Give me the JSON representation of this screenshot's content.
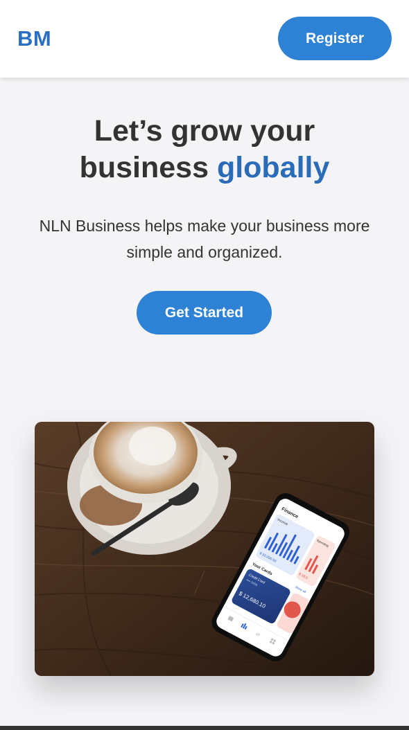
{
  "header": {
    "logo": "BM",
    "register_label": "Register"
  },
  "hero": {
    "title_line1": "Let’s grow your",
    "title_line2_plain": "business ",
    "title_line2_accent": "globally",
    "subtitle": "NLN Business helps make your business more simple and organized.",
    "cta_label": "Get Started"
  },
  "photo": {
    "phone_screen_title": "Finance",
    "income_label": "Income",
    "income_value": "$ 32,000.50",
    "spending_label": "Spending",
    "spending_value": "$ 18,0",
    "cards_label": "Your Cards",
    "show_all_label": "Show all",
    "card_name": "Credit Card",
    "card_number": "•••• 3456",
    "card_balance": "$ 12,680.10"
  },
  "colors": {
    "accent": "#2e82d6",
    "logo": "#2a6fc2",
    "title_accent": "#2a6cb8",
    "background": "#f4f4f6"
  }
}
